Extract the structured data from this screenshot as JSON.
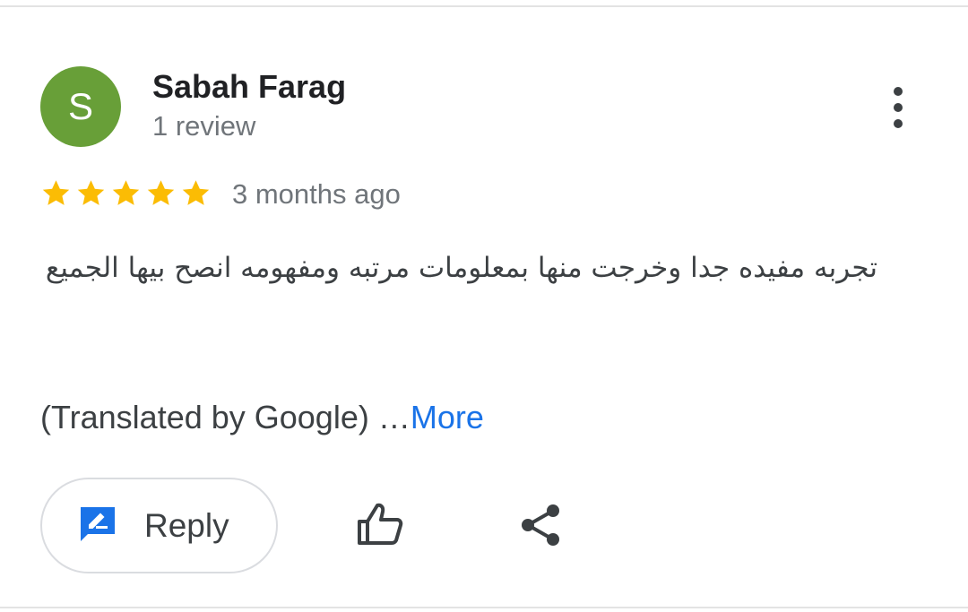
{
  "review": {
    "author": {
      "initial": "S",
      "name": "Sabah Farag",
      "review_count": "1 review",
      "avatar_color": "#689f38"
    },
    "rating": 5,
    "rating_max": 5,
    "star_color": "#fbbc04",
    "time_ago": "3 months ago",
    "text": "تجربه مفيده جدا وخرجت منها بمعلومات مرتبه ومفهومه انصح بيها الجميع",
    "translated_prefix": "(Translated by Google) …",
    "more_link": "More"
  },
  "actions": {
    "reply_label": "Reply",
    "reply_icon": "reply-edit-icon",
    "like_icon": "thumbs-up-icon",
    "share_icon": "share-icon",
    "menu_icon": "more-vert-icon"
  },
  "colors": {
    "accent": "#1a73e8",
    "text_primary": "#202124",
    "text_secondary": "#70757a"
  }
}
